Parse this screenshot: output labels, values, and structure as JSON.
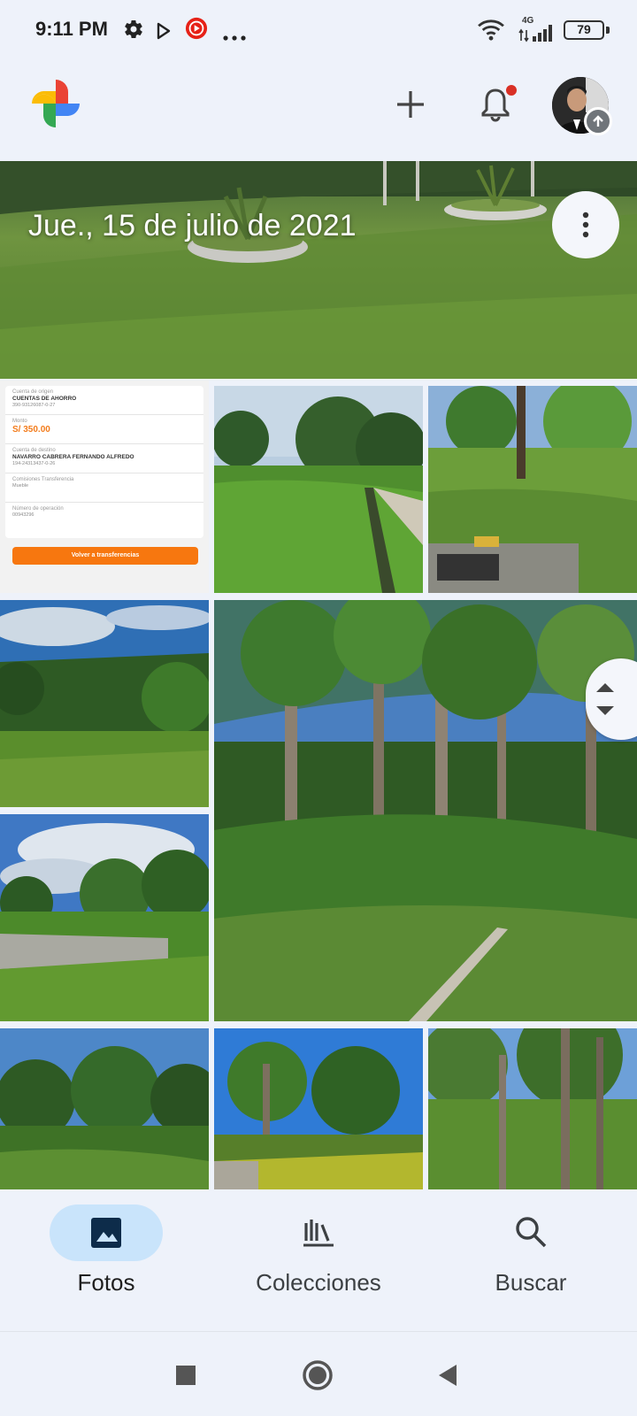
{
  "status_bar": {
    "time": "9:11 PM",
    "battery": "79",
    "network": "4G",
    "icons": [
      "settings-gear-icon",
      "play-store-icon",
      "youtube-music-icon",
      "more-dots-icon",
      "wifi-icon",
      "signal-icon",
      "battery-icon"
    ]
  },
  "header": {
    "logo_icon": "google-photos-logo",
    "actions": [
      {
        "name": "add",
        "icon": "plus-icon"
      },
      {
        "name": "notifications",
        "icon": "bell-icon",
        "has_badge": true
      },
      {
        "name": "account",
        "icon": "avatar",
        "badge_icon": "upload-arrow-icon"
      }
    ]
  },
  "feed": {
    "date_label": "Jue., 15 de julio de 2021",
    "more_icon": "more-vertical-icon",
    "receipt": {
      "origin_label": "Cuenta de origen",
      "origin_value": "CUENTAS DE AHORRO",
      "origin_number": "390-93126087-0-27",
      "amount_label": "Monto",
      "amount_value": "S/ 350.00",
      "dest_label": "Cuenta de destino",
      "dest_value": "NAVARRO CABRERA FERNANDO ALFREDO",
      "dest_number": "194-24313437-0-26",
      "comments_label": "Comisiones Transferencia",
      "comments_value": "Mueble",
      "op_label": "Número de operación",
      "op_value": "00943296",
      "button_label": "Volver a transferencias"
    },
    "scroll_icon": "scroll-up-down-icon"
  },
  "bottom_nav": {
    "items": [
      {
        "label": "Fotos",
        "icon": "photo-icon",
        "active": true
      },
      {
        "label": "Colecciones",
        "icon": "library-icon",
        "active": false
      },
      {
        "label": "Buscar",
        "icon": "search-icon",
        "active": false
      }
    ]
  },
  "system_nav": {
    "icons": [
      "recents-square-icon",
      "home-circle-icon",
      "back-triangle-icon"
    ]
  },
  "colors": {
    "background": "#eef2fa",
    "active_pill": "#c9e4fb",
    "notification_dot": "#d93025",
    "receipt_accent": "#f7770f"
  }
}
